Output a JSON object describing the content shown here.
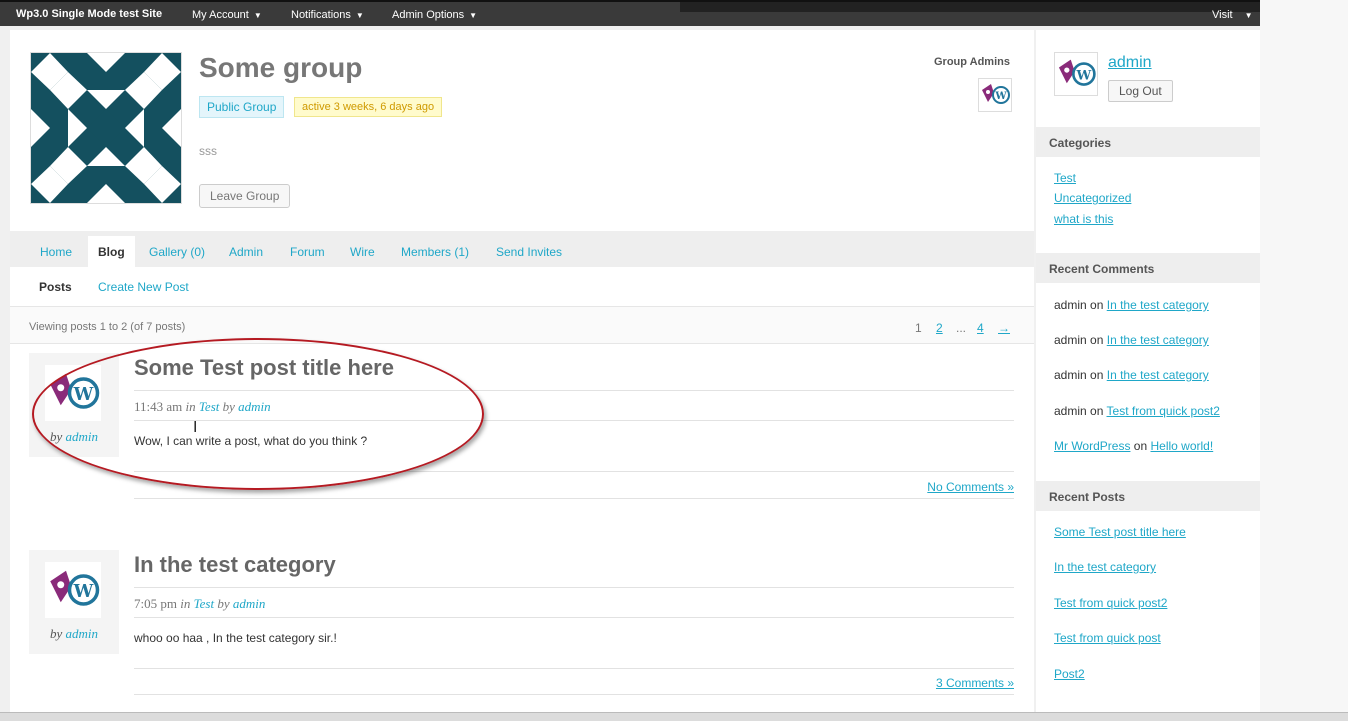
{
  "admin_bar": {
    "site_name": "Wp3.0 Single Mode test Site",
    "menus": [
      "My Account",
      "Notifications",
      "Admin Options"
    ],
    "visit_label": "Visit"
  },
  "group": {
    "title": "Some group",
    "type_badge": "Public Group",
    "activity_badge": "active 3 weeks, 6 days ago",
    "description": "sss",
    "leave_button": "Leave Group",
    "admins_label": "Group Admins"
  },
  "tabs": [
    {
      "label": "Home",
      "active": false
    },
    {
      "label": "Blog",
      "active": true
    },
    {
      "label": "Gallery (0)",
      "active": false
    },
    {
      "label": "Admin",
      "active": false
    },
    {
      "label": "Forum",
      "active": false
    },
    {
      "label": "Wire",
      "active": false
    },
    {
      "label": "Members (1)",
      "active": false
    },
    {
      "label": "Send Invites",
      "active": false
    }
  ],
  "subnav": {
    "posts": "Posts",
    "create": "Create New Post"
  },
  "pagination": {
    "count_text": "Viewing posts 1 to 2 (of 7 posts)",
    "pages": [
      "1",
      "2",
      "...",
      "4",
      "→"
    ]
  },
  "posts": [
    {
      "title": "Some Test post title here",
      "time": "11:43 am",
      "in_word": "in",
      "category": "Test",
      "by_word": "by",
      "author": "admin",
      "excerpt": "Wow, I can write a post, what do you think ?",
      "comments": "No Comments »"
    },
    {
      "title": "In the test category",
      "time": "7:05 pm",
      "in_word": "in",
      "category": "Test",
      "by_word": "by",
      "author": "admin",
      "excerpt": "whoo oo haa , In the test category sir.!",
      "comments": "3 Comments »"
    }
  ],
  "sidebar": {
    "username": "admin",
    "logout": "Log Out",
    "categories_title": "Categories",
    "categories": [
      "Test",
      "Uncategorized",
      "what is this"
    ],
    "recent_comments_title": "Recent Comments",
    "on_word": "on",
    "recent_comments": [
      {
        "author": "admin",
        "post": "In the test category"
      },
      {
        "author": "admin",
        "post": "In the test category"
      },
      {
        "author": "admin",
        "post": "In the test category"
      },
      {
        "author": "admin",
        "post": "Test from quick post2"
      },
      {
        "author": "Mr WordPress",
        "post": "Hello world!"
      }
    ],
    "recent_posts_title": "Recent Posts",
    "recent_posts": [
      "Some Test post title here",
      "In the test category",
      "Test from quick post2",
      "Test from quick post",
      "Post2"
    ]
  },
  "icons": {
    "group_avatar": "quilt-pattern-icon",
    "user_avatar": "buddypress-wordpress-logo-icon",
    "dropdown": "caret-down-icon",
    "text_cursor": "i-beam-cursor-icon"
  },
  "colors": {
    "accent": "#1fa7c8",
    "admin_bar": "#3a3a3a",
    "group_avatar": "#14505f",
    "annotation": "#b51a22"
  }
}
